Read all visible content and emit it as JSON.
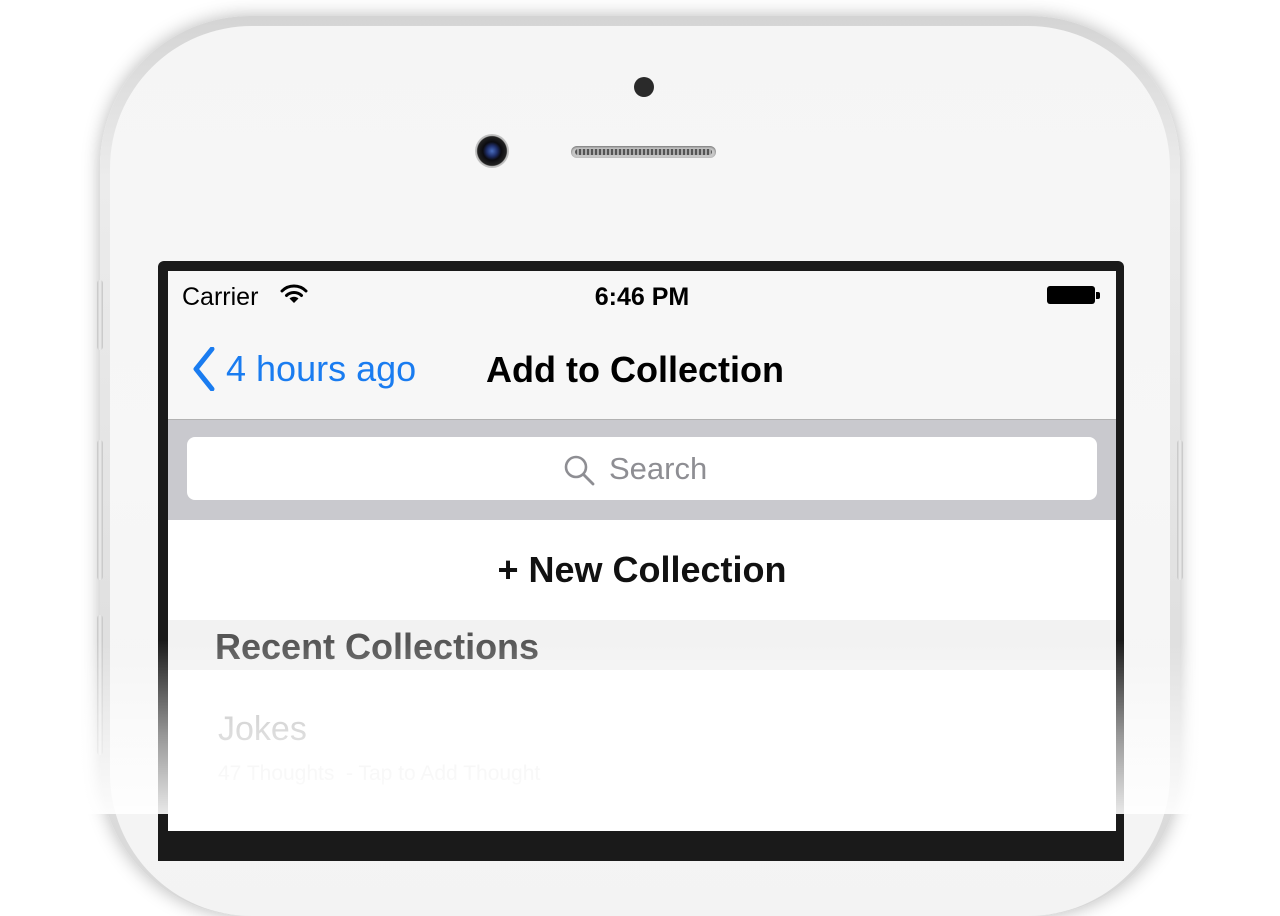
{
  "device": {
    "hardware_icons": [
      "front-camera-icon",
      "earpiece-speaker-icon",
      "proximity-sensor-icon"
    ]
  },
  "status_bar": {
    "carrier": "Carrier",
    "time": "6:46 PM",
    "icons": [
      "wifi-icon",
      "battery-icon"
    ]
  },
  "nav_bar": {
    "back_label": "4 hours ago",
    "title": "Add to Collection",
    "colors": {
      "accent": "#1a7cf0"
    }
  },
  "search": {
    "placeholder": "Search",
    "value": ""
  },
  "actions": {
    "new_collection_label": "+ New Collection"
  },
  "recent": {
    "header": "Recent Collections",
    "items": [
      {
        "title": "Jokes",
        "subtitle": "47 Thoughts  - Tap to Add Thought"
      }
    ]
  }
}
